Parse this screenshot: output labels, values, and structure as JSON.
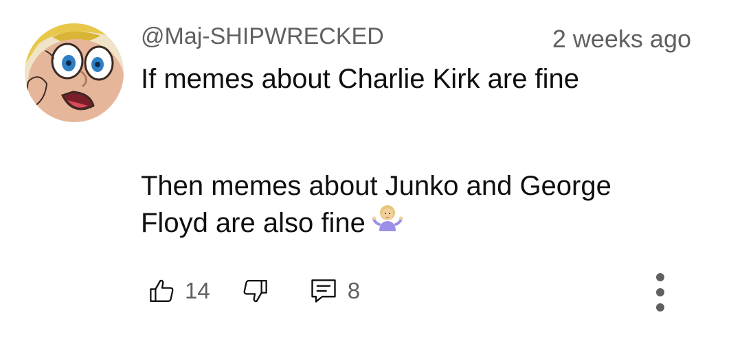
{
  "comment": {
    "username": "@Maj-SHIPWRECKED",
    "timestamp": "2 weeks ago",
    "lines": [
      "If memes about Charlie Kirk are fine",
      "Then memes about Junko and George",
      "Floyd are also fine"
    ],
    "emoji": "person-shrugging-emoji",
    "likes": "14",
    "replies": "8"
  },
  "icons": {
    "like": "thumbs-up-icon",
    "dislike": "thumbs-down-icon",
    "reply": "comment-icon",
    "more": "more-vertical-icon"
  },
  "colors": {
    "text": "#0f0f0f",
    "secondary": "#606060",
    "background": "#ffffff"
  }
}
